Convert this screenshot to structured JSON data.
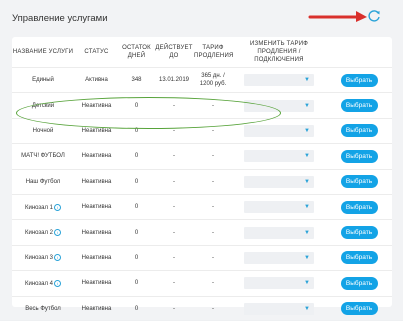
{
  "page": {
    "title": "Управление услугами"
  },
  "columns": {
    "name": "НАЗВАНИЕ УСЛУГИ",
    "status": "СТАТУС",
    "days": "ОСТАТОК ДНЕЙ",
    "until": "ДЕЙСТВУЕТ ДО",
    "tariff": "ТАРИФ ПРОДЛЕНИЯ",
    "change": "ИЗМЕНИТЬ ТАРИФ ПРОДЛЕНИЯ / ПОДКЛЮЧЕНИЯ"
  },
  "rows": [
    {
      "name": "Единый",
      "info": false,
      "status": "Активна",
      "days": "348",
      "until": "13.01.2019",
      "tariff": "365 дн. / 1200 руб.",
      "button": "Выбрать",
      "highlighted": true
    },
    {
      "name": "Детский",
      "info": false,
      "status": "Неактивна",
      "days": "0",
      "until": "-",
      "tariff": "-",
      "button": "Выбрать"
    },
    {
      "name": "Ночной",
      "info": false,
      "status": "Неактивна",
      "days": "0",
      "until": "-",
      "tariff": "-",
      "button": "Выбрать"
    },
    {
      "name": "МАТЧ! ФУТБОЛ",
      "info": false,
      "status": "Неактивна",
      "days": "0",
      "until": "-",
      "tariff": "-",
      "button": "Выбрать"
    },
    {
      "name": "Наш Футбол",
      "info": false,
      "status": "Неактивна",
      "days": "0",
      "until": "-",
      "tariff": "-",
      "button": "Выбрать"
    },
    {
      "name": "Кинозал 1",
      "info": true,
      "status": "Неактивна",
      "days": "0",
      "until": "-",
      "tariff": "-",
      "button": "Выбрать"
    },
    {
      "name": "Кинозал 2",
      "info": true,
      "status": "Неактивна",
      "days": "0",
      "until": "-",
      "tariff": "-",
      "button": "Выбрать"
    },
    {
      "name": "Кинозал 3",
      "info": true,
      "status": "Неактивна",
      "days": "0",
      "until": "-",
      "tariff": "-",
      "button": "Выбрать"
    },
    {
      "name": "Кинозал 4",
      "info": true,
      "status": "Неактивна",
      "days": "0",
      "until": "-",
      "tariff": "-",
      "button": "Выбрать"
    },
    {
      "name": "Весь Футбол",
      "info": false,
      "status": "Неактивна",
      "days": "0",
      "until": "-",
      "tariff": "-",
      "button": "Выбрать"
    }
  ],
  "icons": {
    "refresh": "refresh-icon",
    "info": "info-icon",
    "dropdown": "chevron-down-icon"
  },
  "colors": {
    "accent": "#13a3e6",
    "arrow": "#d9302c",
    "highlight": "#57a33a"
  }
}
